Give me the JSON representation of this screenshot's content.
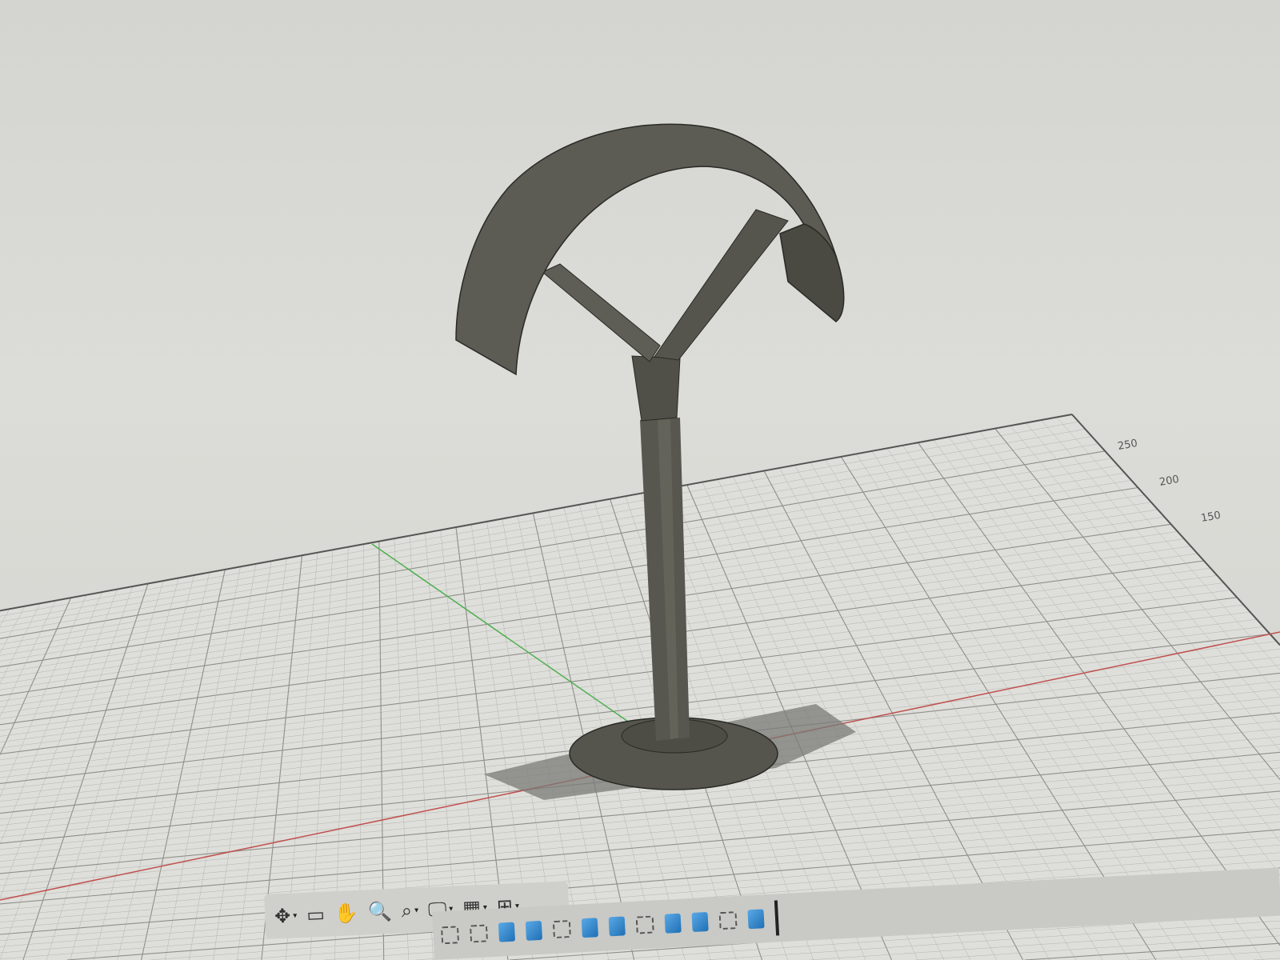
{
  "viewport": {
    "grid_axis_labels": [
      "250",
      "200",
      "150"
    ],
    "colors": {
      "background": "#d6d6d2",
      "grid": "#9a9a96",
      "x_axis": "#c0504d",
      "y_axis": "#4caf50",
      "model": "#5a5a52",
      "shadow": "#7a7a76"
    }
  },
  "nav_toolbar": {
    "items": [
      {
        "icon": "orbit-icon",
        "glyph": "✥",
        "caret": "▾"
      },
      {
        "icon": "look-at-icon",
        "glyph": "▭",
        "caret": ""
      },
      {
        "icon": "pan-hand-icon",
        "glyph": "✋",
        "caret": ""
      },
      {
        "icon": "zoom-icon",
        "glyph": "🔍",
        "caret": ""
      },
      {
        "icon": "fit-zoom-window-icon",
        "glyph": "⌕",
        "caret": "▾"
      },
      {
        "icon": "display-settings-icon",
        "glyph": "🖵",
        "caret": "▾"
      },
      {
        "icon": "grid-settings-icon",
        "glyph": "▦",
        "caret": "▾"
      },
      {
        "icon": "viewports-icon",
        "glyph": "⊞",
        "caret": "▾"
      }
    ]
  },
  "timeline": {
    "features": [
      "sketch",
      "sketch",
      "body",
      "body",
      "sketch",
      "body",
      "body",
      "sketch",
      "body",
      "body",
      "sketch",
      "body"
    ]
  }
}
